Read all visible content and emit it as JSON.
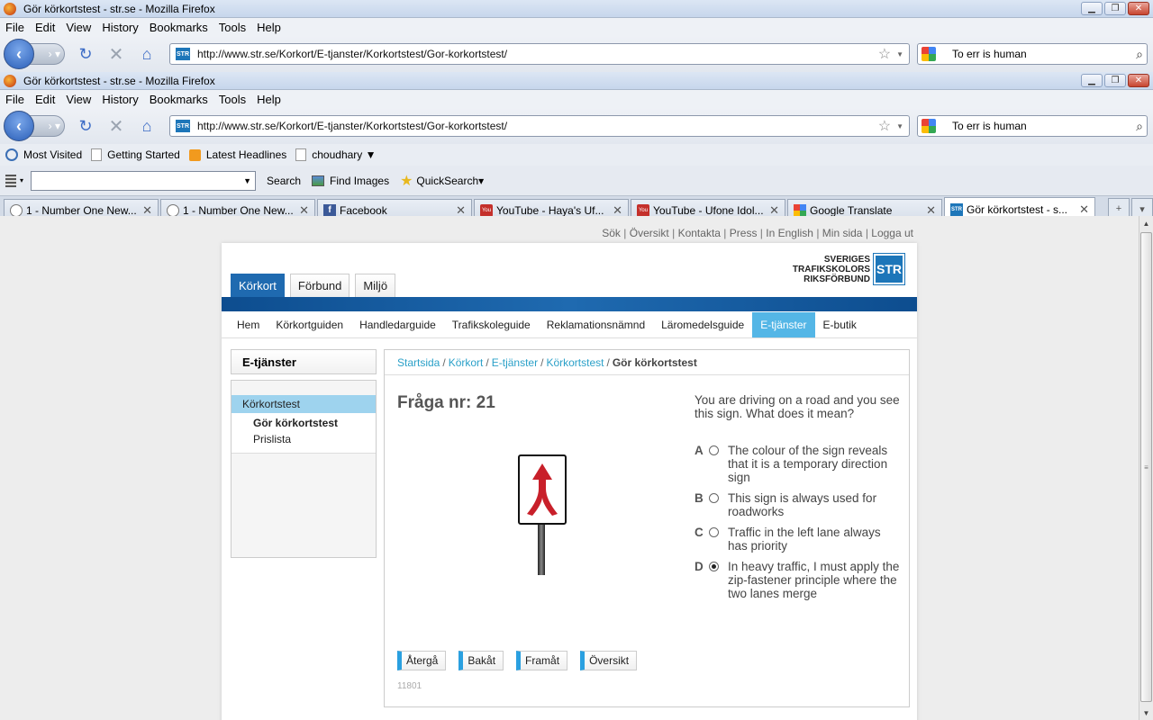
{
  "browser": {
    "window_title": "Gör körkortstest - str.se - Mozilla Firefox",
    "menu": [
      "File",
      "Edit",
      "View",
      "History",
      "Bookmarks",
      "Tools",
      "Help"
    ],
    "url": "http://www.str.se/Korkort/E-tjanster/Korkortstest/Gor-korkortstest/",
    "search_value": "To err is human",
    "bookmarks": [
      "Most Visited",
      "Getting Started",
      "Latest Headlines",
      "choudhary ▼"
    ],
    "toolbar2": {
      "search_label": "Search",
      "find_images": "Find Images",
      "quicksearch": "QuickSearch▾"
    },
    "tabs": [
      {
        "title": "1 - Number One New...",
        "icon": "generic-icon"
      },
      {
        "title": "1 - Number One New...",
        "icon": "generic-icon"
      },
      {
        "title": "Facebook",
        "icon": "facebook-icon"
      },
      {
        "title": "YouTube - Haya's Uf...",
        "icon": "youtube-icon"
      },
      {
        "title": "YouTube - Ufone Idol...",
        "icon": "youtube-icon"
      },
      {
        "title": "Google Translate",
        "icon": "google-icon"
      },
      {
        "title": "Gör körkortstest - s...",
        "icon": "str-icon",
        "active": true
      }
    ]
  },
  "site": {
    "top_links": [
      "Sök",
      "Översikt",
      "Kontakta",
      "Press",
      "In English",
      "Min sida",
      "Logga ut"
    ],
    "logo_lines": [
      "SVERIGES",
      "TRAFIKSKOLORS",
      "RIKSFÖRBUND"
    ],
    "logo_abbr": "STR",
    "main_tabs": [
      "Körkort",
      "Förbund",
      "Miljö"
    ],
    "active_main_tab": "Körkort",
    "subnav": [
      "Hem",
      "Körkortguiden",
      "Handledarguide",
      "Trafikskoleguide",
      "Reklamationsnämnd",
      "Läromedelsguide",
      "E-tjänster",
      "E-butik"
    ],
    "active_subnav": "E-tjänster",
    "left_title": "E-tjänster",
    "left_nav": {
      "selected": "Körkortstest",
      "children": [
        "Gör körkortstest",
        "Prislista"
      ]
    },
    "breadcrumbs": [
      "Startsida",
      "Körkort",
      "E-tjänster",
      "Körkortstest"
    ],
    "breadcrumb_current": "Gör körkortstest",
    "question_heading": "Fråga nr: 21",
    "question_text": "You are driving on a road and you see this sign. What does it mean?",
    "answers": [
      {
        "letter": "A",
        "text": "The colour of the sign reveals that it is a temporary direction sign",
        "selected": false
      },
      {
        "letter": "B",
        "text": "This sign is always used for roadworks",
        "selected": false
      },
      {
        "letter": "C",
        "text": "Traffic in the left lane always has priority",
        "selected": false
      },
      {
        "letter": "D",
        "text": "In heavy traffic, I must apply the zip-fastener principle where the two lanes merge",
        "selected": true
      }
    ],
    "buttons": [
      "Återgå",
      "Bakåt",
      "Framåt",
      "Översikt"
    ],
    "code": "11801"
  }
}
